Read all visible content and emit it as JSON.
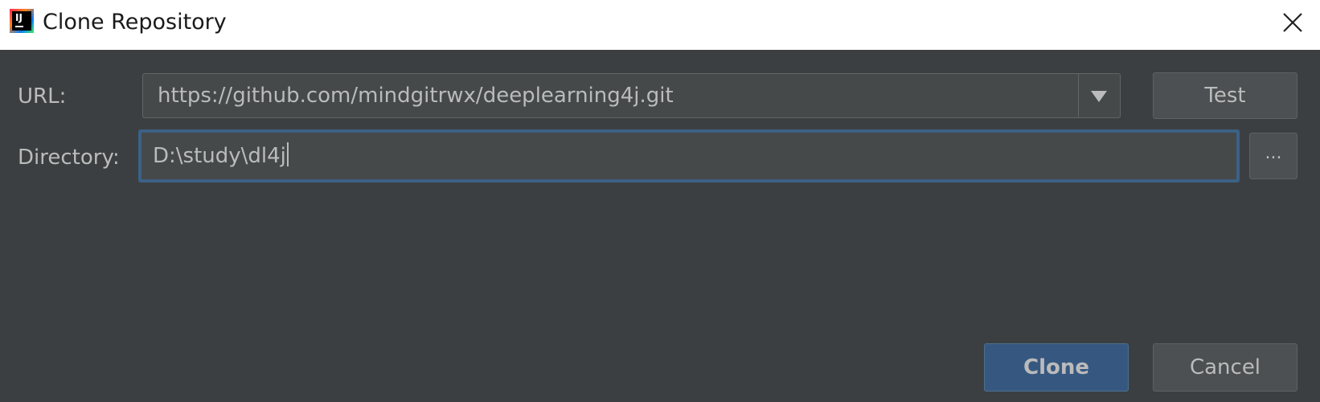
{
  "window": {
    "title": "Clone Repository",
    "app_icon_text": "IJ"
  },
  "url": {
    "label": "URL:",
    "value": "https://github.com/mindgitrwx/deeplearning4j.git",
    "test_button": "Test"
  },
  "directory": {
    "label": "Directory:",
    "value": "D:\\study\\dl4j",
    "browse_button": "..."
  },
  "footer": {
    "clone_button": "Clone",
    "cancel_button": "Cancel"
  },
  "colors": {
    "background": "#3c3f41",
    "field_background": "#45494a",
    "focus_border": "#3d6185",
    "primary_button": "#365880",
    "text": "#bbbbbb"
  },
  "icons": {
    "app": "intellij-idea-icon",
    "close": "close-icon",
    "dropdown": "triangle-down-icon"
  }
}
